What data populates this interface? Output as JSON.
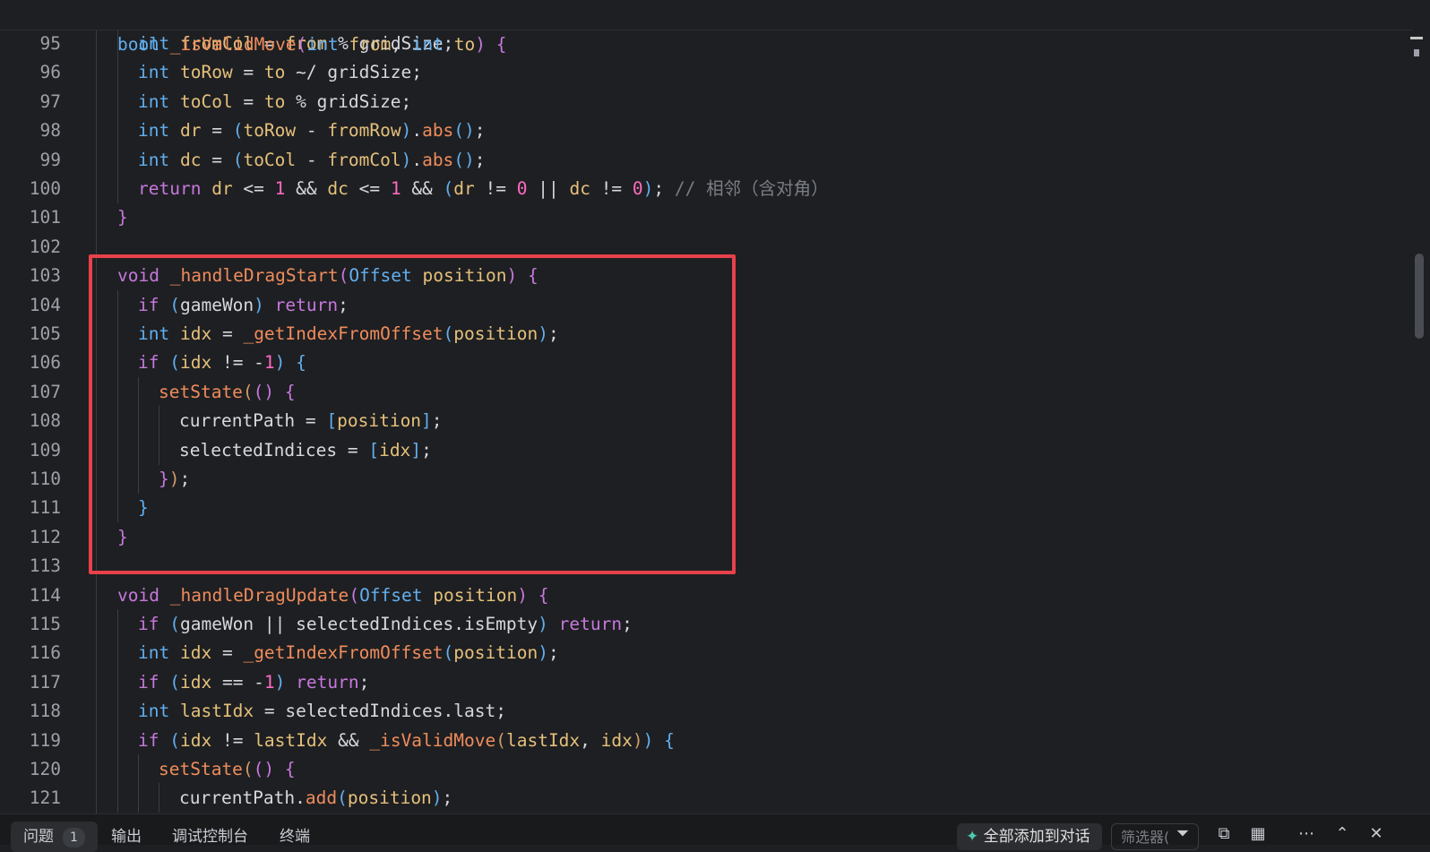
{
  "sticky_header": {
    "line": {
      "tokens": [
        {
          "c": "ty",
          "t": "bool"
        },
        {
          "t": " "
        },
        {
          "c": "fn",
          "t": "_isValidMove"
        },
        {
          "c": "p2",
          "t": "("
        },
        {
          "c": "ty",
          "t": "int"
        },
        {
          "t": " "
        },
        {
          "c": "var",
          "t": "from"
        },
        {
          "t": ", "
        },
        {
          "c": "ty",
          "t": "int"
        },
        {
          "t": " "
        },
        {
          "c": "var",
          "t": "to"
        },
        {
          "c": "p2",
          "t": ")"
        },
        {
          "t": " "
        },
        {
          "c": "p2",
          "t": "{"
        }
      ]
    }
  },
  "code_lines": [
    {
      "n": "95",
      "indent": 1,
      "tokens": [
        {
          "c": "ty",
          "t": "int"
        },
        {
          "t": " "
        },
        {
          "c": "var",
          "t": "fromCol"
        },
        {
          "t": " = "
        },
        {
          "c": "var",
          "t": "from"
        },
        {
          "t": " % gridSize;"
        }
      ]
    },
    {
      "n": "96",
      "indent": 1,
      "tokens": [
        {
          "c": "ty",
          "t": "int"
        },
        {
          "t": " "
        },
        {
          "c": "var",
          "t": "toRow"
        },
        {
          "t": " = "
        },
        {
          "c": "var",
          "t": "to"
        },
        {
          "t": " ~/ gridSize;"
        }
      ]
    },
    {
      "n": "97",
      "indent": 1,
      "tokens": [
        {
          "c": "ty",
          "t": "int"
        },
        {
          "t": " "
        },
        {
          "c": "var",
          "t": "toCol"
        },
        {
          "t": " = "
        },
        {
          "c": "var",
          "t": "to"
        },
        {
          "t": " % gridSize;"
        }
      ]
    },
    {
      "n": "98",
      "indent": 1,
      "tokens": [
        {
          "c": "ty",
          "t": "int"
        },
        {
          "t": " "
        },
        {
          "c": "var",
          "t": "dr"
        },
        {
          "t": " = "
        },
        {
          "c": "p3",
          "t": "("
        },
        {
          "c": "var",
          "t": "toRow"
        },
        {
          "t": " - "
        },
        {
          "c": "var",
          "t": "fromRow"
        },
        {
          "c": "p3",
          "t": ")"
        },
        {
          "t": "."
        },
        {
          "c": "fn",
          "t": "abs"
        },
        {
          "c": "p3",
          "t": "()"
        },
        {
          "t": ";"
        }
      ]
    },
    {
      "n": "99",
      "indent": 1,
      "tokens": [
        {
          "c": "ty",
          "t": "int"
        },
        {
          "t": " "
        },
        {
          "c": "var",
          "t": "dc"
        },
        {
          "t": " = "
        },
        {
          "c": "p3",
          "t": "("
        },
        {
          "c": "var",
          "t": "toCol"
        },
        {
          "t": " - "
        },
        {
          "c": "var",
          "t": "fromCol"
        },
        {
          "c": "p3",
          "t": ")"
        },
        {
          "t": "."
        },
        {
          "c": "fn",
          "t": "abs"
        },
        {
          "c": "p3",
          "t": "()"
        },
        {
          "t": ";"
        }
      ]
    },
    {
      "n": "100",
      "indent": 1,
      "tokens": [
        {
          "c": "kw",
          "t": "return"
        },
        {
          "t": " "
        },
        {
          "c": "var",
          "t": "dr"
        },
        {
          "t": " <= "
        },
        {
          "c": "num",
          "t": "1"
        },
        {
          "t": " && "
        },
        {
          "c": "var",
          "t": "dc"
        },
        {
          "t": " <= "
        },
        {
          "c": "num",
          "t": "1"
        },
        {
          "t": " && "
        },
        {
          "c": "p3",
          "t": "("
        },
        {
          "c": "var",
          "t": "dr"
        },
        {
          "t": " != "
        },
        {
          "c": "num",
          "t": "0"
        },
        {
          "t": " || "
        },
        {
          "c": "var",
          "t": "dc"
        },
        {
          "t": " != "
        },
        {
          "c": "num",
          "t": "0"
        },
        {
          "c": "p3",
          "t": ")"
        },
        {
          "t": "; "
        },
        {
          "c": "cm",
          "t": "// 相邻（含对角）"
        }
      ]
    },
    {
      "n": "101",
      "indent": 0,
      "tokens": [
        {
          "c": "p2",
          "t": "}"
        }
      ]
    },
    {
      "n": "102",
      "indent": 0,
      "tokens": []
    },
    {
      "n": "103",
      "indent": 0,
      "tokens": [
        {
          "c": "kw",
          "t": "void"
        },
        {
          "t": " "
        },
        {
          "c": "fn",
          "t": "_handleDragStart"
        },
        {
          "c": "p2",
          "t": "("
        },
        {
          "c": "ty",
          "t": "Offset"
        },
        {
          "t": " "
        },
        {
          "c": "var",
          "t": "position"
        },
        {
          "c": "p2",
          "t": ")"
        },
        {
          "t": " "
        },
        {
          "c": "p2",
          "t": "{"
        }
      ]
    },
    {
      "n": "104",
      "indent": 1,
      "tokens": [
        {
          "c": "kw",
          "t": "if"
        },
        {
          "t": " "
        },
        {
          "c": "p3",
          "t": "("
        },
        {
          "t": "gameWon"
        },
        {
          "c": "p3",
          "t": ")"
        },
        {
          "t": " "
        },
        {
          "c": "kw",
          "t": "return"
        },
        {
          "t": ";"
        }
      ]
    },
    {
      "n": "105",
      "indent": 1,
      "tokens": [
        {
          "c": "ty",
          "t": "int"
        },
        {
          "t": " "
        },
        {
          "c": "var",
          "t": "idx"
        },
        {
          "t": " = "
        },
        {
          "c": "fn",
          "t": "_getIndexFromOffset"
        },
        {
          "c": "p3",
          "t": "("
        },
        {
          "c": "var",
          "t": "position"
        },
        {
          "c": "p3",
          "t": ")"
        },
        {
          "t": ";"
        }
      ]
    },
    {
      "n": "106",
      "indent": 1,
      "tokens": [
        {
          "c": "kw",
          "t": "if"
        },
        {
          "t": " "
        },
        {
          "c": "p3",
          "t": "("
        },
        {
          "c": "var",
          "t": "idx"
        },
        {
          "t": " != -"
        },
        {
          "c": "num",
          "t": "1"
        },
        {
          "c": "p3",
          "t": ")"
        },
        {
          "t": " "
        },
        {
          "c": "p3",
          "t": "{"
        }
      ]
    },
    {
      "n": "107",
      "indent": 2,
      "tokens": [
        {
          "c": "fn",
          "t": "setState"
        },
        {
          "c": "p1",
          "t": "("
        },
        {
          "c": "p2",
          "t": "()"
        },
        {
          "t": " "
        },
        {
          "c": "p2",
          "t": "{"
        }
      ]
    },
    {
      "n": "108",
      "indent": 3,
      "tokens": [
        {
          "t": "currentPath = "
        },
        {
          "c": "p3",
          "t": "["
        },
        {
          "c": "var",
          "t": "position"
        },
        {
          "c": "p3",
          "t": "]"
        },
        {
          "t": ";"
        }
      ]
    },
    {
      "n": "109",
      "indent": 3,
      "tokens": [
        {
          "t": "selectedIndices = "
        },
        {
          "c": "p3",
          "t": "["
        },
        {
          "c": "var",
          "t": "idx"
        },
        {
          "c": "p3",
          "t": "]"
        },
        {
          "t": ";"
        }
      ]
    },
    {
      "n": "110",
      "indent": 2,
      "tokens": [
        {
          "c": "p2",
          "t": "}"
        },
        {
          "c": "p1",
          "t": ")"
        },
        {
          "t": ";"
        }
      ]
    },
    {
      "n": "111",
      "indent": 1,
      "tokens": [
        {
          "c": "p3",
          "t": "}"
        }
      ]
    },
    {
      "n": "112",
      "indent": 0,
      "tokens": [
        {
          "c": "p2",
          "t": "}"
        }
      ]
    },
    {
      "n": "113",
      "indent": 0,
      "tokens": []
    },
    {
      "n": "114",
      "indent": 0,
      "tokens": [
        {
          "c": "kw",
          "t": "void"
        },
        {
          "t": " "
        },
        {
          "c": "fn",
          "t": "_handleDragUpdate"
        },
        {
          "c": "p2",
          "t": "("
        },
        {
          "c": "ty",
          "t": "Offset"
        },
        {
          "t": " "
        },
        {
          "c": "var",
          "t": "position"
        },
        {
          "c": "p2",
          "t": ")"
        },
        {
          "t": " "
        },
        {
          "c": "p2",
          "t": "{"
        }
      ]
    },
    {
      "n": "115",
      "indent": 1,
      "tokens": [
        {
          "c": "kw",
          "t": "if"
        },
        {
          "t": " "
        },
        {
          "c": "p3",
          "t": "("
        },
        {
          "t": "gameWon || selectedIndices.isEmpty"
        },
        {
          "c": "p3",
          "t": ")"
        },
        {
          "t": " "
        },
        {
          "c": "kw",
          "t": "return"
        },
        {
          "t": ";"
        }
      ]
    },
    {
      "n": "116",
      "indent": 1,
      "tokens": [
        {
          "c": "ty",
          "t": "int"
        },
        {
          "t": " "
        },
        {
          "c": "var",
          "t": "idx"
        },
        {
          "t": " = "
        },
        {
          "c": "fn",
          "t": "_getIndexFromOffset"
        },
        {
          "c": "p3",
          "t": "("
        },
        {
          "c": "var",
          "t": "position"
        },
        {
          "c": "p3",
          "t": ")"
        },
        {
          "t": ";"
        }
      ]
    },
    {
      "n": "117",
      "indent": 1,
      "tokens": [
        {
          "c": "kw",
          "t": "if"
        },
        {
          "t": " "
        },
        {
          "c": "p3",
          "t": "("
        },
        {
          "c": "var",
          "t": "idx"
        },
        {
          "t": " == -"
        },
        {
          "c": "num",
          "t": "1"
        },
        {
          "c": "p3",
          "t": ")"
        },
        {
          "t": " "
        },
        {
          "c": "kw",
          "t": "return"
        },
        {
          "t": ";"
        }
      ]
    },
    {
      "n": "118",
      "indent": 1,
      "tokens": [
        {
          "c": "ty",
          "t": "int"
        },
        {
          "t": " "
        },
        {
          "c": "var",
          "t": "lastIdx"
        },
        {
          "t": " = selectedIndices.last;"
        }
      ]
    },
    {
      "n": "119",
      "indent": 1,
      "tokens": [
        {
          "c": "kw",
          "t": "if"
        },
        {
          "t": " "
        },
        {
          "c": "p3",
          "t": "("
        },
        {
          "c": "var",
          "t": "idx"
        },
        {
          "t": " != "
        },
        {
          "c": "var",
          "t": "lastIdx"
        },
        {
          "t": " && "
        },
        {
          "c": "fn",
          "t": "_isValidMove"
        },
        {
          "c": "p1",
          "t": "("
        },
        {
          "c": "var",
          "t": "lastIdx"
        },
        {
          "t": ", "
        },
        {
          "c": "var",
          "t": "idx"
        },
        {
          "c": "p1",
          "t": ")"
        },
        {
          "c": "p3",
          "t": ")"
        },
        {
          "t": " "
        },
        {
          "c": "p3",
          "t": "{"
        }
      ]
    },
    {
      "n": "120",
      "indent": 2,
      "tokens": [
        {
          "c": "fn",
          "t": "setState"
        },
        {
          "c": "p1",
          "t": "("
        },
        {
          "c": "p2",
          "t": "()"
        },
        {
          "t": " "
        },
        {
          "c": "p2",
          "t": "{"
        }
      ]
    },
    {
      "n": "121",
      "indent": 3,
      "tokens": [
        {
          "t": "currentPath."
        },
        {
          "c": "fn",
          "t": "add"
        },
        {
          "c": "p3",
          "t": "("
        },
        {
          "c": "var",
          "t": "position"
        },
        {
          "c": "p3",
          "t": ")"
        },
        {
          "t": ";"
        }
      ]
    }
  ],
  "bottom_panel": {
    "tabs": [
      "问题",
      "输出",
      "调试控制台",
      "终端"
    ],
    "problems_count": "1",
    "add_to_chat_label": "全部添加到对话",
    "filter_placeholder": "筛选器(",
    "icons": [
      "filter-icon",
      "copy-icon",
      "layout-icon",
      "more-icon",
      "chevron-up-icon",
      "close-icon"
    ]
  }
}
